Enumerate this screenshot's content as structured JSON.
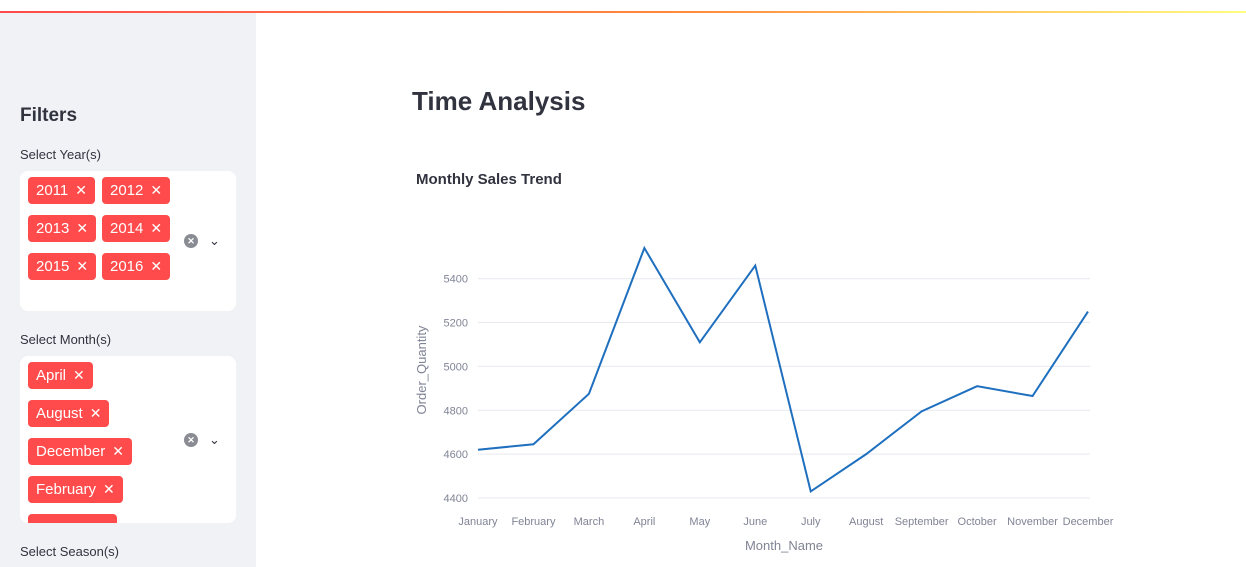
{
  "sidebar": {
    "title": "Filters",
    "year_filter": {
      "label": "Select Year(s)",
      "selected": [
        "2011",
        "2012",
        "2013",
        "2014",
        "2015",
        "2016"
      ]
    },
    "month_filter": {
      "label": "Select Month(s)",
      "selected": [
        "April",
        "August",
        "December",
        "February"
      ]
    },
    "season_filter": {
      "label": "Select Season(s)"
    }
  },
  "icons": {
    "tag_remove": "close-icon",
    "clear_all": "clear-circle-icon",
    "dropdown": "chevron-down-icon"
  },
  "colors": {
    "accent": "#ff4b4b",
    "line": "#1f6fbf",
    "sidebar_bg": "#f0f2f6"
  },
  "main": {
    "title": "Time Analysis"
  },
  "chart_data": {
    "type": "line",
    "title": "Monthly Sales Trend",
    "xlabel": "Month_Name",
    "ylabel": "Order_Quantity",
    "categories": [
      "January",
      "February",
      "March",
      "April",
      "May",
      "June",
      "July",
      "August",
      "September",
      "October",
      "November",
      "December"
    ],
    "series": [
      {
        "values": [
          4620,
          4645,
          4875,
          5540,
          5110,
          5460,
          4430,
          4600,
          4795,
          4910,
          4865,
          5250
        ]
      }
    ],
    "yticks": [
      4400,
      4600,
      4800,
      5000,
      5200,
      5400
    ],
    "ylim": [
      4400,
      5540
    ],
    "grid": true
  }
}
